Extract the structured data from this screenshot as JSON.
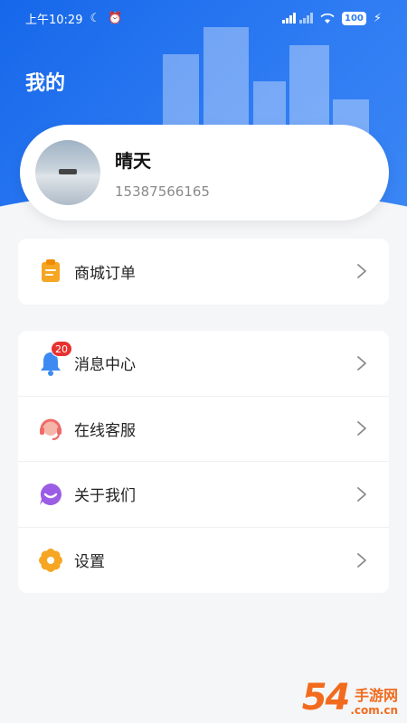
{
  "status_bar": {
    "time": "上午10:29",
    "battery": "100"
  },
  "header": {
    "title": "我的"
  },
  "profile": {
    "name": "晴天",
    "phone": "15387566165"
  },
  "orders_card": {
    "items": [
      {
        "label": "商城订单",
        "icon": "clipboard-icon",
        "color": "#f5a623"
      }
    ]
  },
  "menu_card": {
    "items": [
      {
        "label": "消息中心",
        "icon": "bell-icon",
        "color": "#3d8bf2",
        "badge": "20"
      },
      {
        "label": "在线客服",
        "icon": "headset-icon",
        "color": "#f06a6a"
      },
      {
        "label": "关于我们",
        "icon": "chat-bubble-icon",
        "color": "#9b5de5"
      },
      {
        "label": "设置",
        "icon": "gear-icon",
        "color": "#f5a623"
      }
    ]
  },
  "watermark": {
    "number": "54",
    "site_cn": "手游网",
    "url": ".com.cn"
  }
}
